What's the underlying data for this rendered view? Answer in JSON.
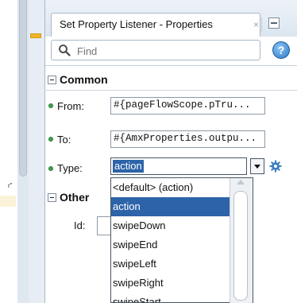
{
  "panel": {
    "tab_title": "Set Property Listener - Properties",
    "close_glyph": "×",
    "left_marker_text": "r\""
  },
  "search": {
    "placeholder": "Find",
    "value": ""
  },
  "help": {
    "label": "?"
  },
  "sections": {
    "common": {
      "label": "Common",
      "from_label": "From:",
      "from_value": "#{pageFlowScope.pTru...",
      "to_label": "To:",
      "to_value": "#{AmxProperties.outpu...",
      "type_label": "Type:",
      "type_value": "action"
    },
    "other": {
      "label": "Other",
      "id_label": "Id:",
      "id_value": ""
    }
  },
  "type_dropdown": {
    "options": [
      "<default> (action)",
      "action",
      "swipeDown",
      "swipeEnd",
      "swipeLeft",
      "swipeRight",
      "swipeStart"
    ],
    "selected": "action"
  },
  "colors": {
    "accent": "#2d63a8",
    "required_dot": "#3fa34d",
    "gear": "#3c7fc1",
    "marker": "#f0b429"
  },
  "icons": [
    "search-icon",
    "help-icon",
    "close-icon",
    "minimize-icon",
    "gear-icon",
    "collapse-icon",
    "chevron-down-icon"
  ]
}
